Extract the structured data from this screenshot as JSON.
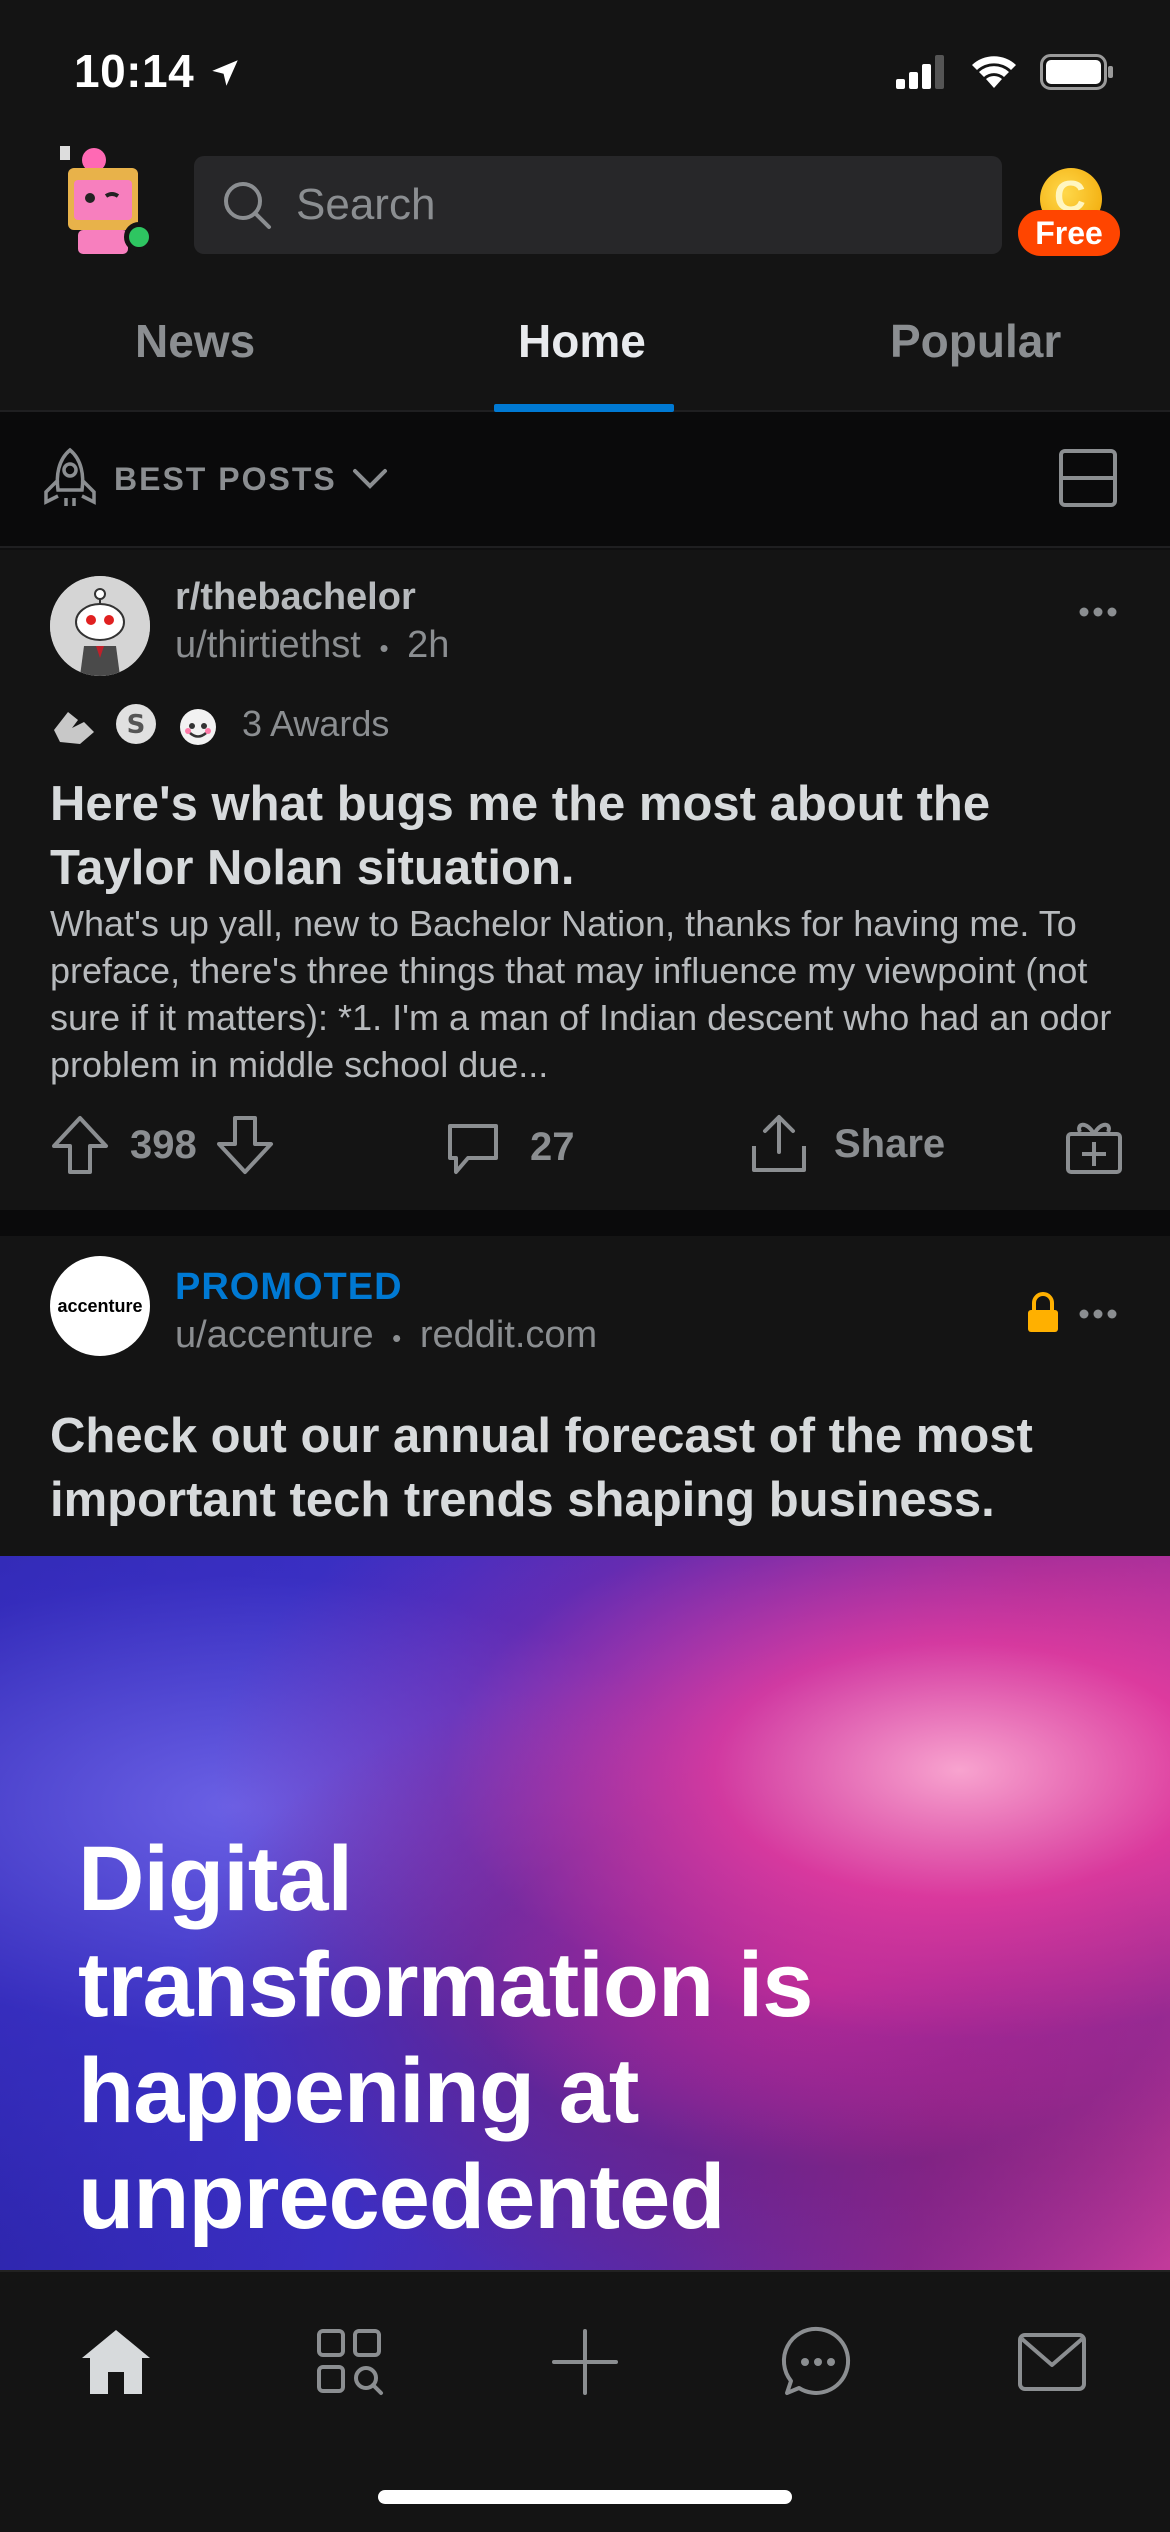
{
  "status_bar": {
    "time": "10:14"
  },
  "header": {
    "search_placeholder": "Search",
    "coin_badge": "Free"
  },
  "tabs": [
    {
      "label": "News"
    },
    {
      "label": "Home",
      "active": true
    },
    {
      "label": "Popular"
    }
  ],
  "sort": {
    "label": "BEST POSTS"
  },
  "posts": [
    {
      "subreddit": "r/thebachelor",
      "user": "u/thirtiethst",
      "time_sep": "•",
      "time": "2h",
      "awards_label": "3 Awards",
      "title": "Here's what bugs me the most about the Taylor Nolan situation.",
      "body": "What's up yall, new to Bachelor Nation, thanks for having me. To preface, there's three things that may influence my viewpoint (not sure if it matters): *1. I'm a man of Indian descent who had an odor problem in middle school due...",
      "votes": "398",
      "comments": "27",
      "share_label": "Share"
    },
    {
      "promoted_label": "PROMOTED",
      "brand_logo_text": "accenture",
      "user": "u/accenture",
      "sep": "•",
      "domain": "reddit.com",
      "title": "Check out our annual forecast of the most important tech trends shaping business.",
      "image_headline": "Digital transformation is happening at unprecedented"
    }
  ],
  "colors": {
    "accent_blue": "#0079d3",
    "orange": "#ff4500",
    "lock": "#ffb000",
    "online": "#2ec561"
  },
  "icons": {
    "nav": [
      "home-icon",
      "discover-icon",
      "create-post-icon",
      "chat-icon",
      "inbox-icon"
    ]
  }
}
